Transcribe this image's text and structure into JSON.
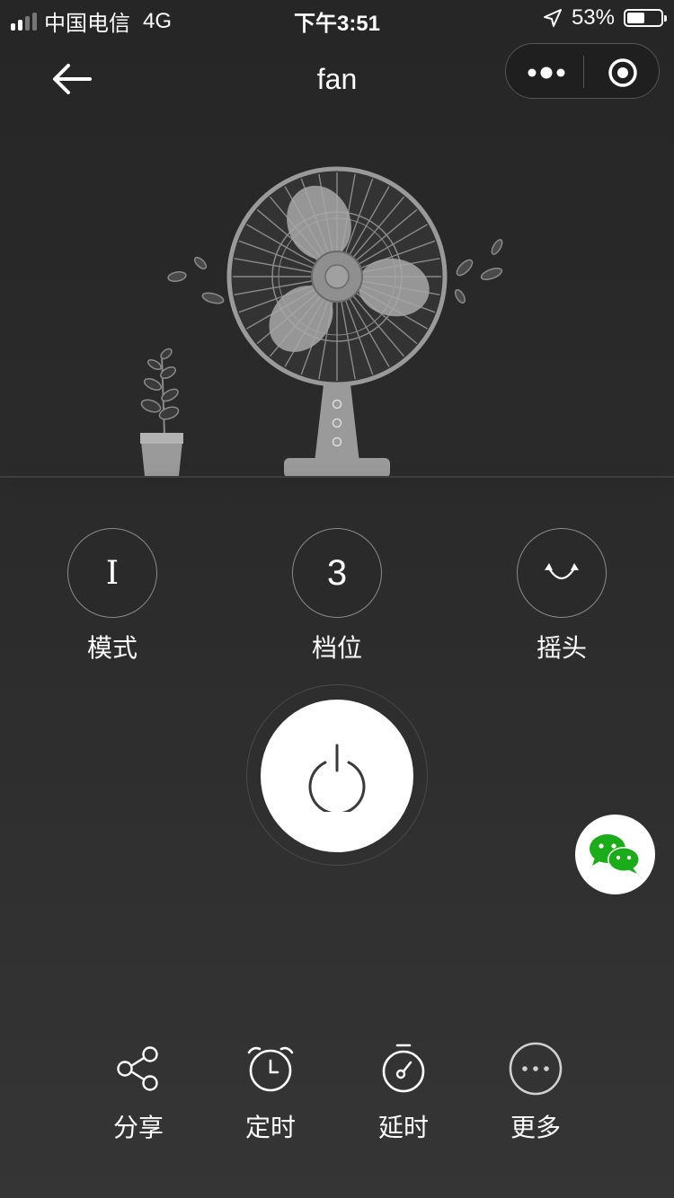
{
  "status_bar": {
    "carrier": "中国电信",
    "network": "4G",
    "time": "下午3:51",
    "battery_percent": "53%",
    "battery_level": 0.53,
    "signal_bars_active": 2,
    "signal_bars_total": 4
  },
  "nav": {
    "title": "fan"
  },
  "controls": {
    "mode": {
      "label": "模式",
      "value": "I"
    },
    "gear": {
      "label": "档位",
      "value": "3"
    },
    "swing": {
      "label": "摇头"
    }
  },
  "bottom_bar": {
    "share_label": "分享",
    "timer_label": "定时",
    "delay_label": "延时",
    "more_label": "更多"
  },
  "colors": {
    "background": "#2b2b2b",
    "power_button": "#ffffff",
    "wechat_green": "#1aad19",
    "outline_gray": "#8a8a8a"
  }
}
